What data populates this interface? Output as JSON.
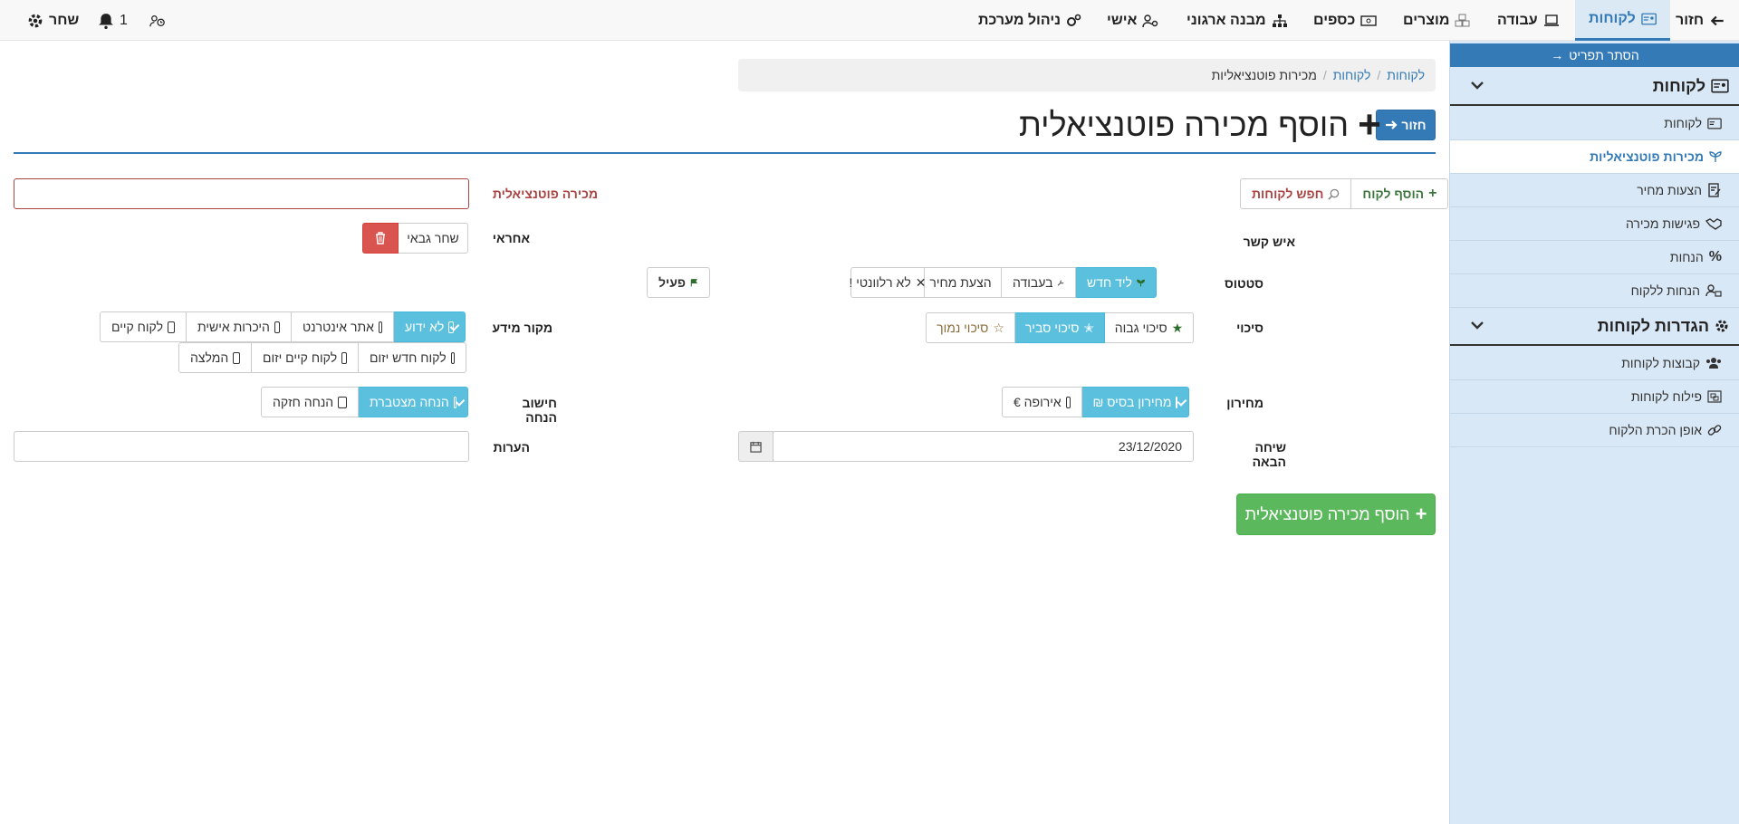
{
  "topnav": {
    "back": "חזור",
    "customers": "לקוחות",
    "work": "עבודה",
    "products": "מוצרים",
    "money": "כספים",
    "org": "מבנה ארגוני",
    "personal": "אישי",
    "admin": "ניהול מערכת",
    "notif_count": "1",
    "user": "שחר"
  },
  "sidebar": {
    "collapse": "הסתר תפריט",
    "section1": "לקוחות",
    "items1": [
      "לקוחות",
      "מכירות פוטנציאליות",
      "הצעות מחיר",
      "פגישות מכירה",
      "הנחות",
      "הנחות ללקוח"
    ],
    "section2": "הגדרות לקוחות",
    "items2": [
      "קבוצות לקוחות",
      "פילוח לקוחות",
      "אופן הכרת הלקוח"
    ]
  },
  "breadcrumb": {
    "root": "לקוחות",
    "mid": "לקוחות",
    "current": "מכירות פוטנציאליות"
  },
  "page": {
    "back_button": "חזור",
    "title": "הוסף מכירה פוטנציאלית",
    "submit": "הוסף מכירה פוטנציאלית"
  },
  "form": {
    "contact": {
      "label": "איש קשר",
      "add_button": "הוסף לקוח",
      "search_button": "חפש לקוחות"
    },
    "potential_sale": {
      "label": "מכירה פוטנציאלית",
      "value": ""
    },
    "responsible": {
      "label": "אחראי",
      "value": "שחר גבאי"
    },
    "status": {
      "label": "סטטוס",
      "options": [
        "ליד חדש",
        "בעבודה",
        "הצעת מחיר",
        "לא רלוונטי !"
      ],
      "selected": "ליד חדש",
      "active_button": "פעיל"
    },
    "chance": {
      "label": "סיכוי",
      "options": [
        "סיכוי גבוה",
        "סיכוי סביר",
        "סיכוי נמוך"
      ],
      "selected": "סיכוי סביר"
    },
    "source": {
      "label": "מקור מידע",
      "row1": [
        "לא ידוע",
        "אתר אינטרנט",
        "היכרות אישית",
        "לקוח קיים"
      ],
      "row2": [
        "לקוח חדש יזום",
        "לקוח קיים יזום",
        "המלצה"
      ],
      "selected": "לא ידוע"
    },
    "pricelist": {
      "label": "מחירון",
      "options": [
        "מחירון בסיס ₪",
        "אירופה €"
      ],
      "selected": "מחירון בסיס ₪"
    },
    "discount_calc": {
      "label": "חישוב הנחה",
      "options": [
        "הנחה מצטברת",
        "הנחה חזקה"
      ],
      "selected": "הנחה מצטברת"
    },
    "next_call": {
      "label": "שיחה הבאה",
      "value": "23/12/2020"
    },
    "notes": {
      "label": "הערות",
      "value": ""
    }
  },
  "colors": {
    "primary": "#337ab7",
    "info": "#5bc0de",
    "success": "#5cb85c",
    "danger": "#d9534f",
    "sidebar_bg": "#d9e8f6"
  }
}
